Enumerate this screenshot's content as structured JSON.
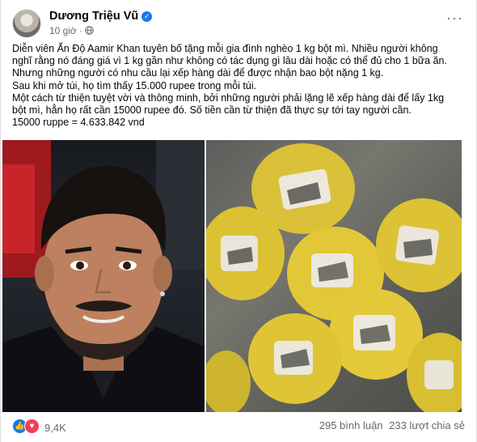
{
  "post": {
    "author": "Dương Triệu Vũ",
    "time": "10 giờ",
    "separator": "·",
    "more_label": "···",
    "paragraphs": [
      "Diễn viên Ấn Độ Aamir Khan tuyên bố tặng mỗi gia đình nghèo 1 kg bột mì. Nhiều người không",
      "nghĩ rằng nó đáng giá vì 1 kg gần như không có tác dụng gì lâu dài hoặc có thể đủ cho 1 bữa ăn.",
      "Nhưng những người có nhu cầu lại xếp hàng dài để được nhận bao bột nặng 1 kg.",
      "Sau khi mở túi, họ tìm thấy 15.000 rupee trong mỗi túi.",
      "Một cách từ thiện tuyệt vời và thông minh, bởi những người phải lặng lẽ xếp hàng dài để lấy 1kg",
      "bột mì, hẳn họ rất cần 15000 rupee đó. Số tiền cần từ thiện đã thực sự tới tay người cần.",
      "15000 ruppe = 4.633.842 vnd"
    ]
  },
  "footer": {
    "reaction_count": "9,4K",
    "comments": "295 bình luận",
    "shares": "233 lượt chia sẻ"
  },
  "icons": {
    "verified": "verified-badge-icon",
    "globe": "globe-icon",
    "like": "like-reaction-icon",
    "love": "love-reaction-icon"
  },
  "colors": {
    "accent": "#1877f2",
    "love": "#f33e58",
    "secondary_text": "#65676b"
  }
}
